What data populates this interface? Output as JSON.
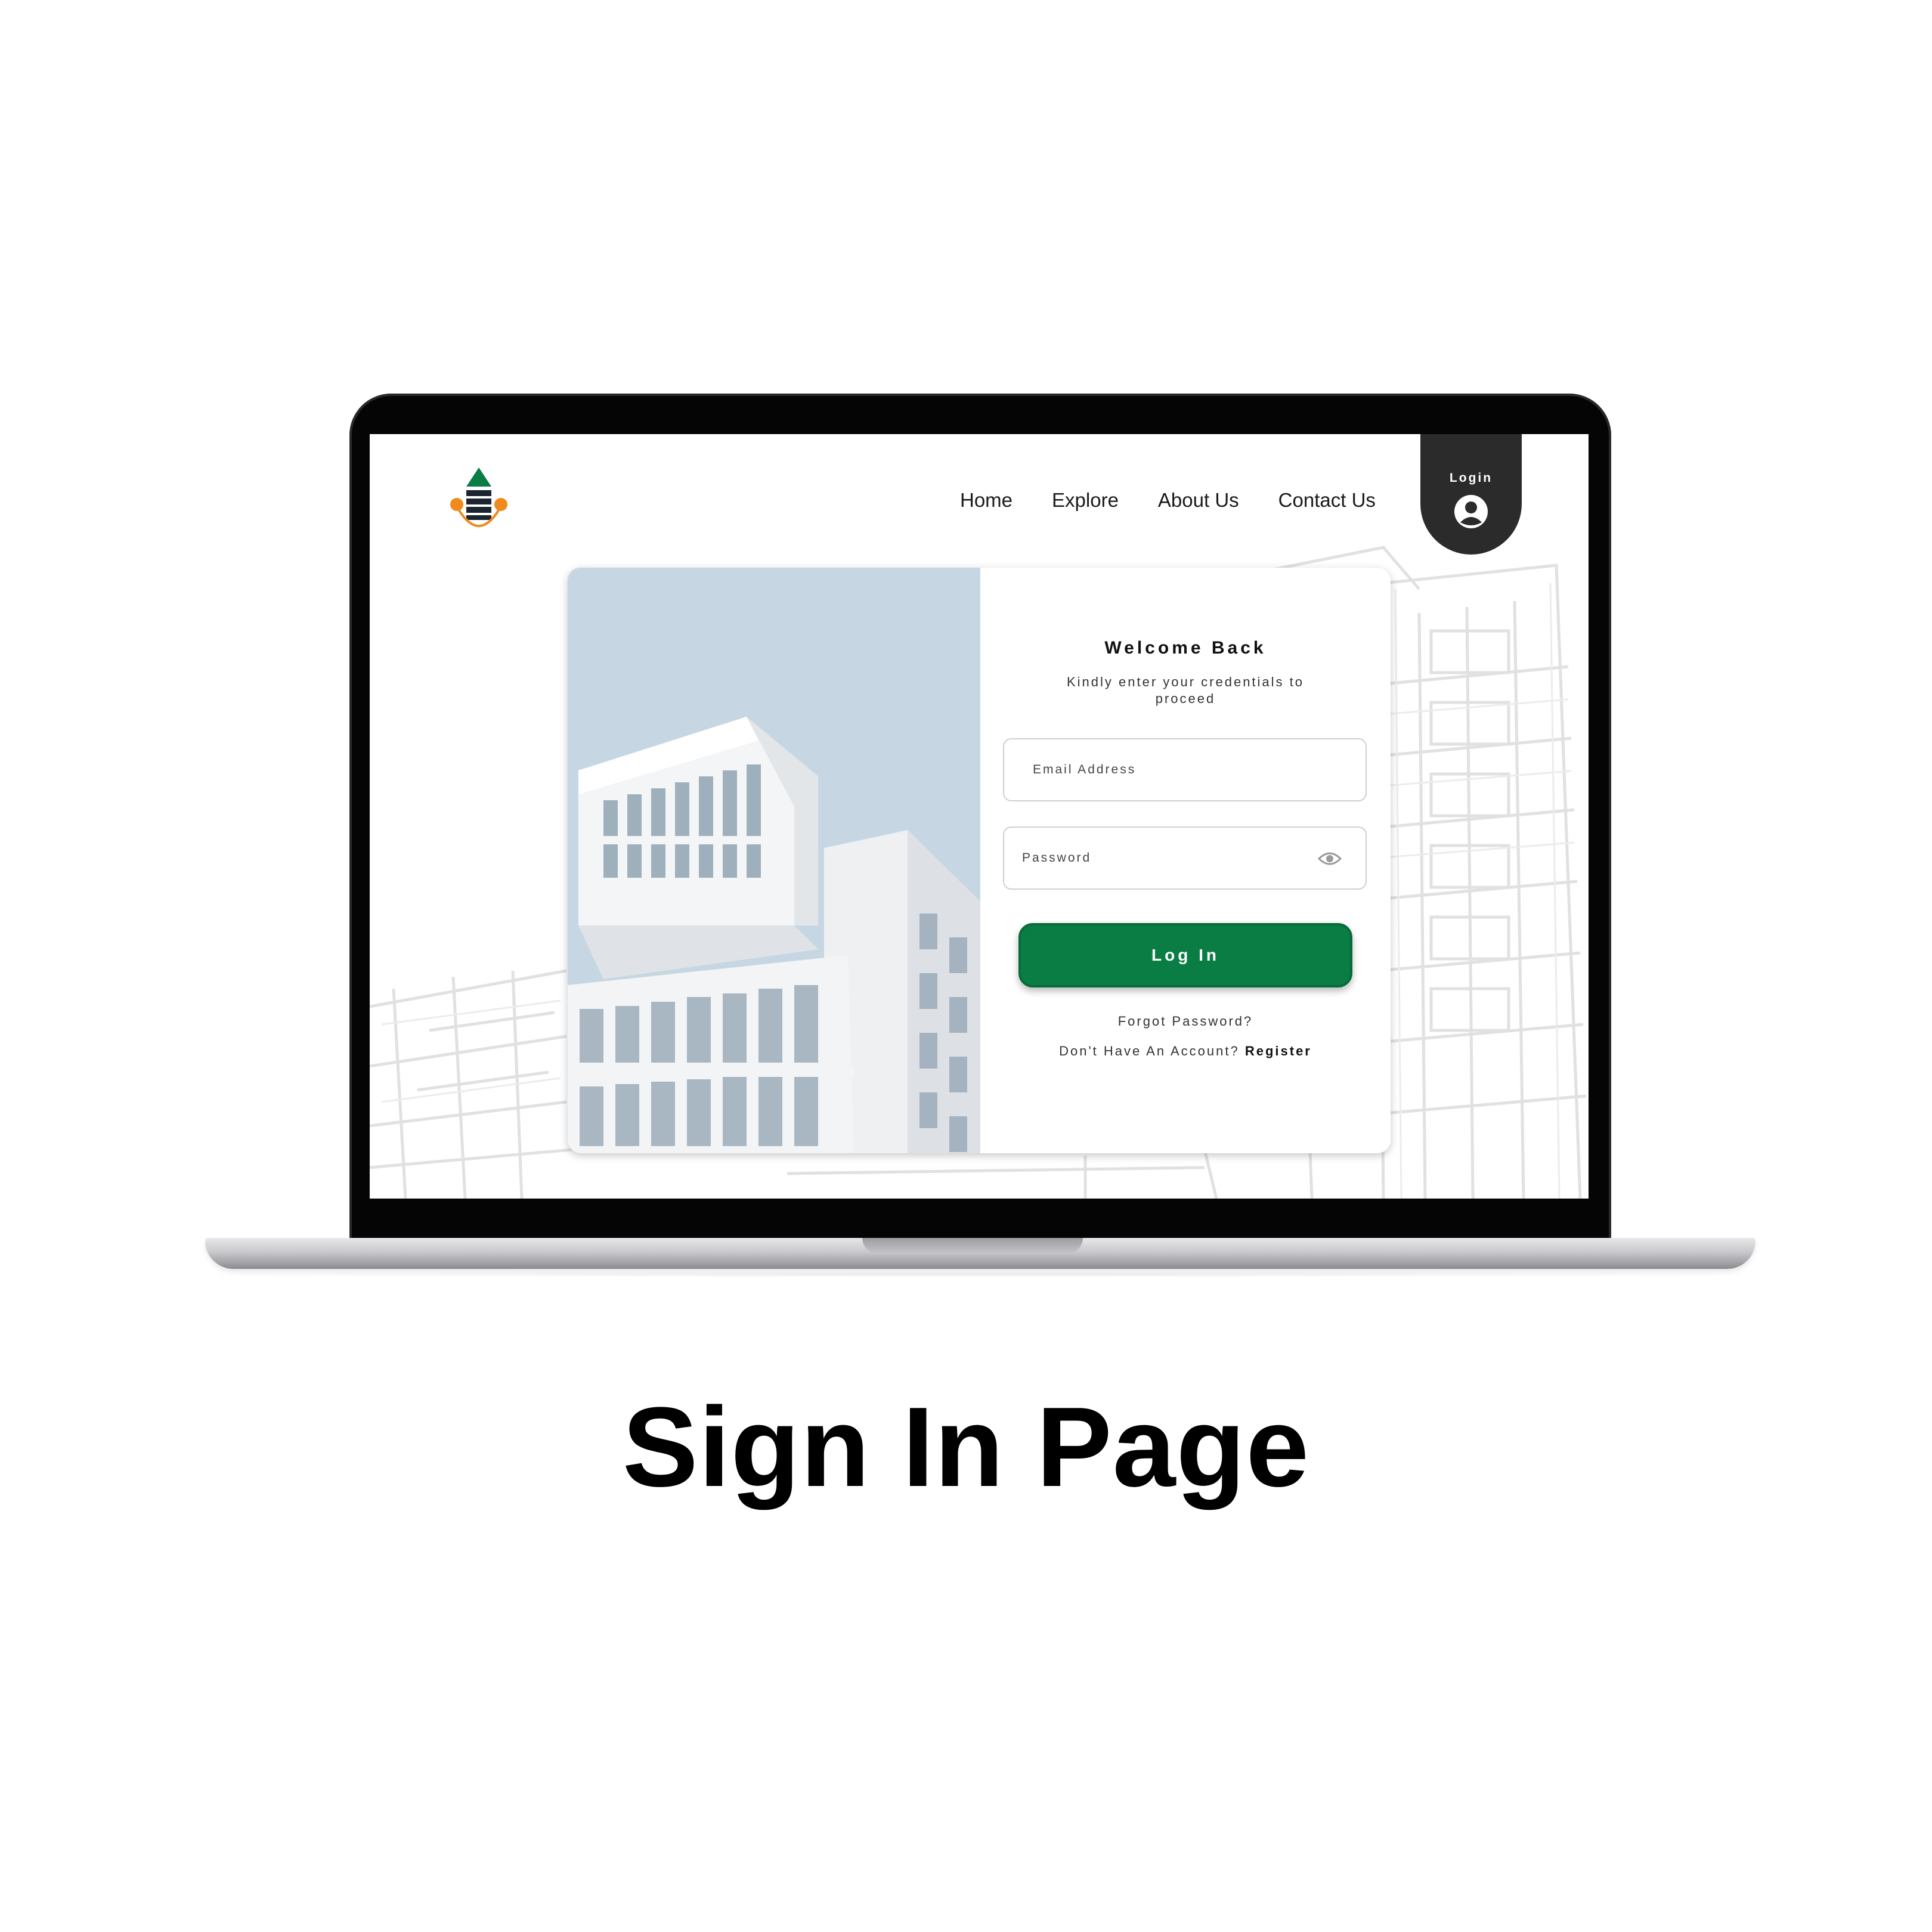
{
  "caption": "Sign In Page",
  "header": {
    "logo": "company-logo",
    "nav": [
      "Home",
      "Explore",
      "About Us",
      "Contact Us"
    ],
    "login_tab_label": "Login"
  },
  "form": {
    "title": "Welcome Back",
    "subtitle": "Kindly enter your credentials to proceed",
    "email_placeholder": "Email Address",
    "password_placeholder": "Password",
    "submit_label": "Log In",
    "forgot_label": "Forgot Password?",
    "no_account_text": "Don't Have An Account?",
    "register_label": "Register"
  },
  "icons": {
    "login_avatar": "user-circle-icon",
    "password_toggle": "eye-icon"
  },
  "colors": {
    "accent_green": "#0a7d45",
    "login_tab": "#2b2b2b",
    "logo_orange": "#f08a1c",
    "logo_green": "#0a7d45"
  }
}
